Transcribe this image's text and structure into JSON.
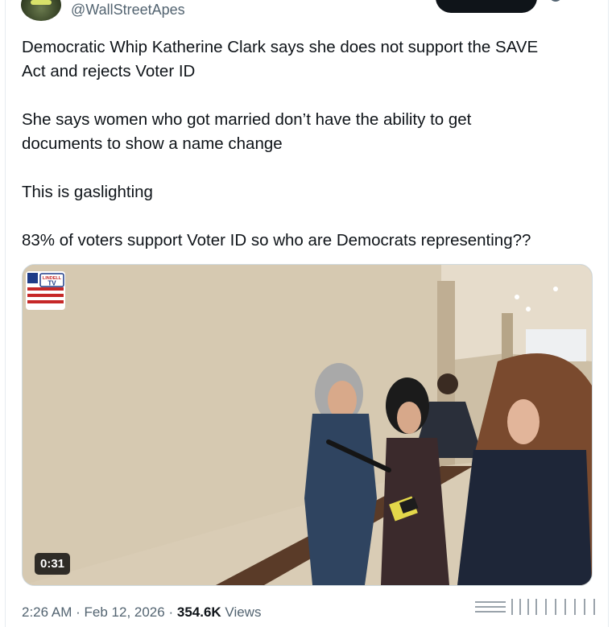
{
  "author": {
    "handle": "@WallStreetApes"
  },
  "tweet": {
    "paragraphs": [
      "Democratic Whip Katherine Clark says she does not support the SAVE\nAct and rejects Voter ID",
      "She says women who got married don’t have the ability to get\ndocuments to show a name change",
      "This is gaslighting",
      "83% of voters support Voter ID so who are Democrats representing??"
    ]
  },
  "video": {
    "duration": "0:31",
    "badge_text": "LINDELL TV"
  },
  "meta": {
    "time": "2:26 AM",
    "date": "Feb 12, 2026",
    "separator": "·",
    "views_count": "354.6K",
    "views_label": "Views"
  }
}
